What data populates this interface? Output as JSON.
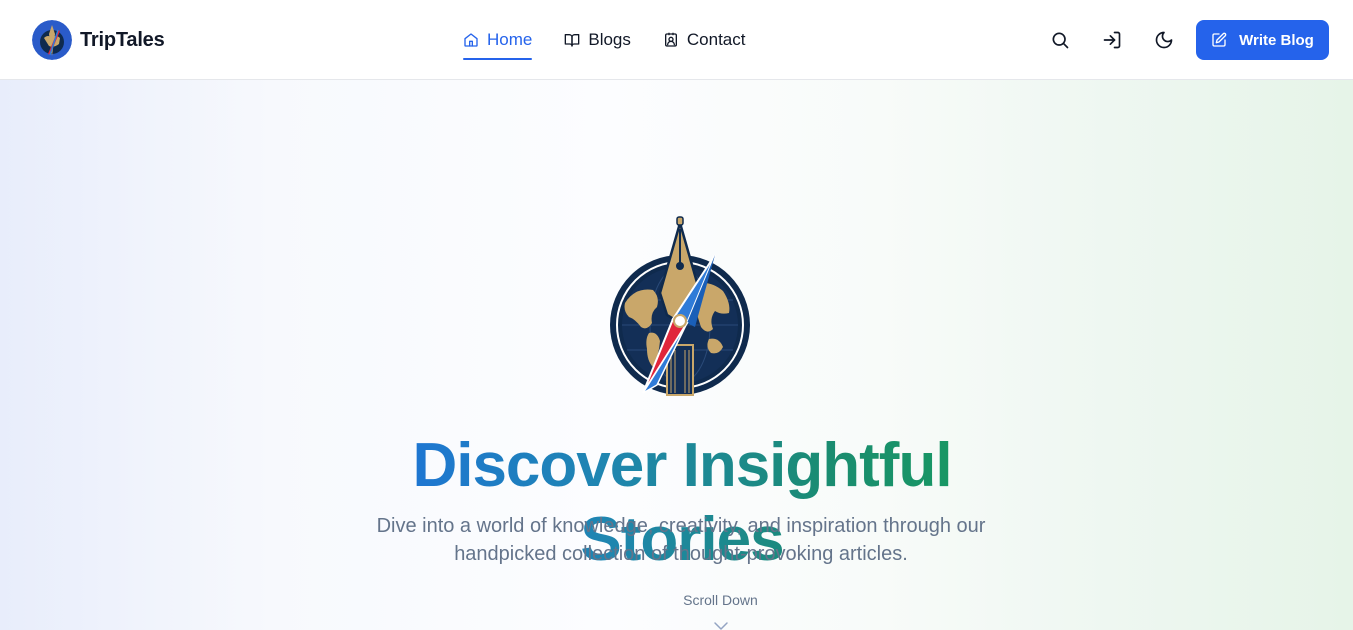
{
  "brand": {
    "name": "TripTales",
    "logo_icon": "compass-pen-globe-logo"
  },
  "nav": {
    "items": [
      {
        "label": "Home",
        "icon": "home-icon",
        "active": true
      },
      {
        "label": "Blogs",
        "icon": "book-open-icon",
        "active": false
      },
      {
        "label": "Contact",
        "icon": "contact-card-icon",
        "active": false
      }
    ]
  },
  "actions": {
    "search_icon": "search-icon",
    "login_icon": "log-in-icon",
    "theme_icon": "moon-icon",
    "write_label": "Write Blog",
    "write_icon": "pencil-square-icon"
  },
  "hero": {
    "title": "Discover Insightful Stories",
    "subtitle": "Dive into a world of knowledge, creativity, and inspiration through our handpicked collection of thought-provoking articles.",
    "scroll_label": "Scroll Down",
    "scroll_icon": "chevron-down-icon"
  },
  "colors": {
    "accent": "#2563eb",
    "title_gradient_start": "#1d6ee3",
    "title_gradient_end": "#16a05a",
    "muted_text": "#64748b",
    "logo_navy": "#0f2a4d",
    "logo_gold": "#c9a76a"
  }
}
